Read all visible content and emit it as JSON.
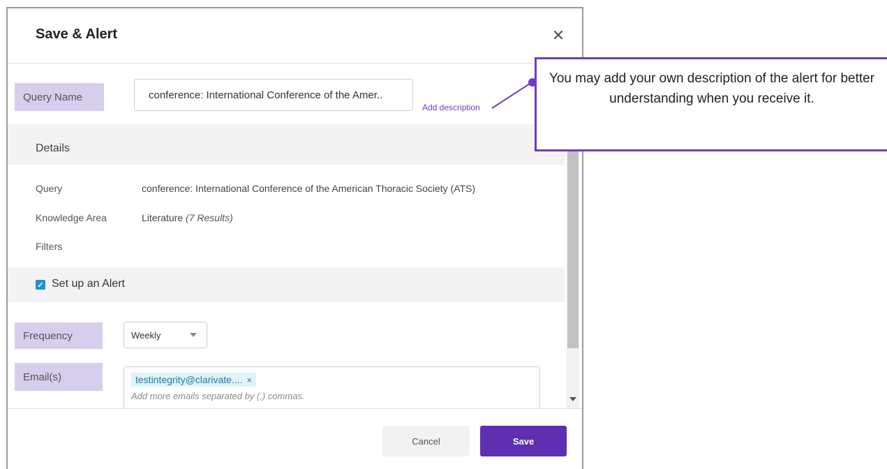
{
  "dialog": {
    "title": "Save & Alert",
    "close_icon": "close-icon",
    "query_name_label": "Query Name",
    "query_name_value": "conference: International Conference of the Amer..",
    "add_description_link": "Add description",
    "details": {
      "heading": "Details",
      "rows": [
        {
          "label": "Query",
          "value": "conference: International Conference of the American Thoracic Society (ATS)"
        },
        {
          "label": "Knowledge Area",
          "value": "Literature",
          "value_note": "(7 Results)"
        },
        {
          "label": "Filters",
          "value": ""
        }
      ]
    },
    "alert": {
      "checkbox_checked": true,
      "checkbox_icon": "checkmark-icon",
      "label": "Set up an Alert",
      "frequency_label": "Frequency",
      "frequency_value": "Weekly",
      "emails_label": "Email(s)",
      "email_chip": "testintegrity@clarivate....",
      "email_chip_remove": "×",
      "email_placeholder": "Add more emails separated by (,) commas."
    },
    "footer": {
      "cancel_label": "Cancel",
      "save_label": "Save"
    }
  },
  "callout": {
    "text": "You may add your own description of the alert for better understanding when you receive it."
  },
  "colors": {
    "accent": "#5e2fb0",
    "label_bg": "#d7cdec",
    "callout_border": "#6a3ec6",
    "checkbox": "#1f8fd6",
    "chip_bg": "#dff3f8"
  }
}
